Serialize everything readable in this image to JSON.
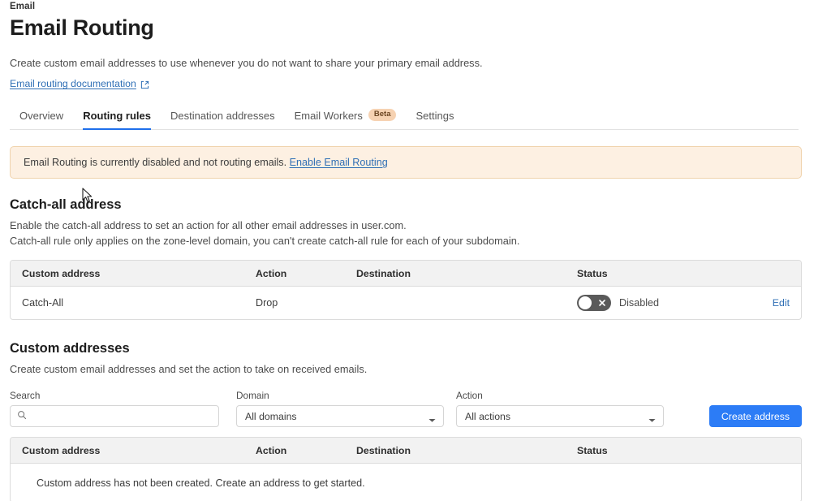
{
  "header": {
    "breadcrumb": "Email",
    "title": "Email Routing",
    "description": "Create custom email addresses to use whenever you do not want to share your primary email address.",
    "doc_link": "Email routing documentation",
    "doc_link_icon": "external-link-icon"
  },
  "tabs": [
    {
      "label": "Overview",
      "active": false
    },
    {
      "label": "Routing rules",
      "active": true
    },
    {
      "label": "Destination addresses",
      "active": false
    },
    {
      "label": "Email Workers",
      "active": false,
      "badge": "Beta"
    },
    {
      "label": "Settings",
      "active": false
    }
  ],
  "alert": {
    "text": "Email Routing is currently disabled and not routing emails.",
    "link": "Enable Email Routing",
    "bg_color": "#fdf0e2",
    "border_color": "#f0d3ad"
  },
  "catch_all": {
    "title": "Catch-all address",
    "desc_line1": "Enable the catch-all address to set an action for all other email addresses in user.com.",
    "desc_line2": "Catch-all rule only applies on the zone-level domain, you can't create catch-all rule for each of your subdomain.",
    "columns": [
      "Custom address",
      "Action",
      "Destination",
      "Status"
    ],
    "row": {
      "address": "Catch-All",
      "action": "Drop",
      "destination": "",
      "status": "Disabled",
      "toggle_on": false,
      "edit_label": "Edit"
    }
  },
  "custom_addresses": {
    "title": "Custom addresses",
    "desc": "Create custom email addresses and set the action to take on received emails.",
    "filters": {
      "search_label": "Search",
      "search_value": "",
      "search_placeholder": "",
      "search_icon": "search-icon",
      "domain_label": "Domain",
      "domain_value": "All domains",
      "action_label": "Action",
      "action_value": "All actions",
      "create_button": "Create address",
      "create_button_color": "#2c7cf6"
    },
    "columns": [
      "Custom address",
      "Action",
      "Destination",
      "Status"
    ],
    "empty_message": "Custom address has not been created. Create an address to get started."
  }
}
